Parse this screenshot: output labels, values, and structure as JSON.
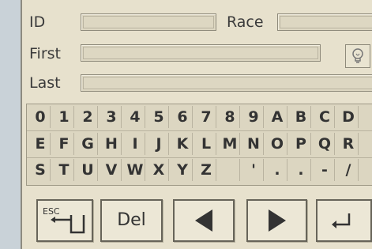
{
  "form": {
    "id_label": "ID",
    "race_label": "Race",
    "first_label": "First",
    "last_label": "Last",
    "id_value": "",
    "race_value": "",
    "first_value": "",
    "last_value": ""
  },
  "keyboard": {
    "rows": [
      [
        "0",
        "1",
        "2",
        "3",
        "4",
        "5",
        "6",
        "7",
        "8",
        "9",
        "A",
        "B",
        "C",
        "D"
      ],
      [
        "E",
        "F",
        "G",
        "H",
        "I",
        "J",
        "K",
        "L",
        "M",
        "N",
        "O",
        "P",
        "Q",
        "R"
      ],
      [
        "S",
        "T",
        "U",
        "V",
        "W",
        "X",
        "Y",
        "Z",
        "",
        "'",
        ".",
        ".",
        "-",
        "/"
      ]
    ]
  },
  "buttons": {
    "esc_label": "ESC",
    "del_label": "Del"
  },
  "icons": {
    "hint": "lightbulb-icon",
    "left": "arrow-left-icon",
    "right": "arrow-right-icon",
    "enter": "enter-icon"
  },
  "colors": {
    "panel_bg": "#e7e1cd",
    "key_text": "#333333"
  }
}
